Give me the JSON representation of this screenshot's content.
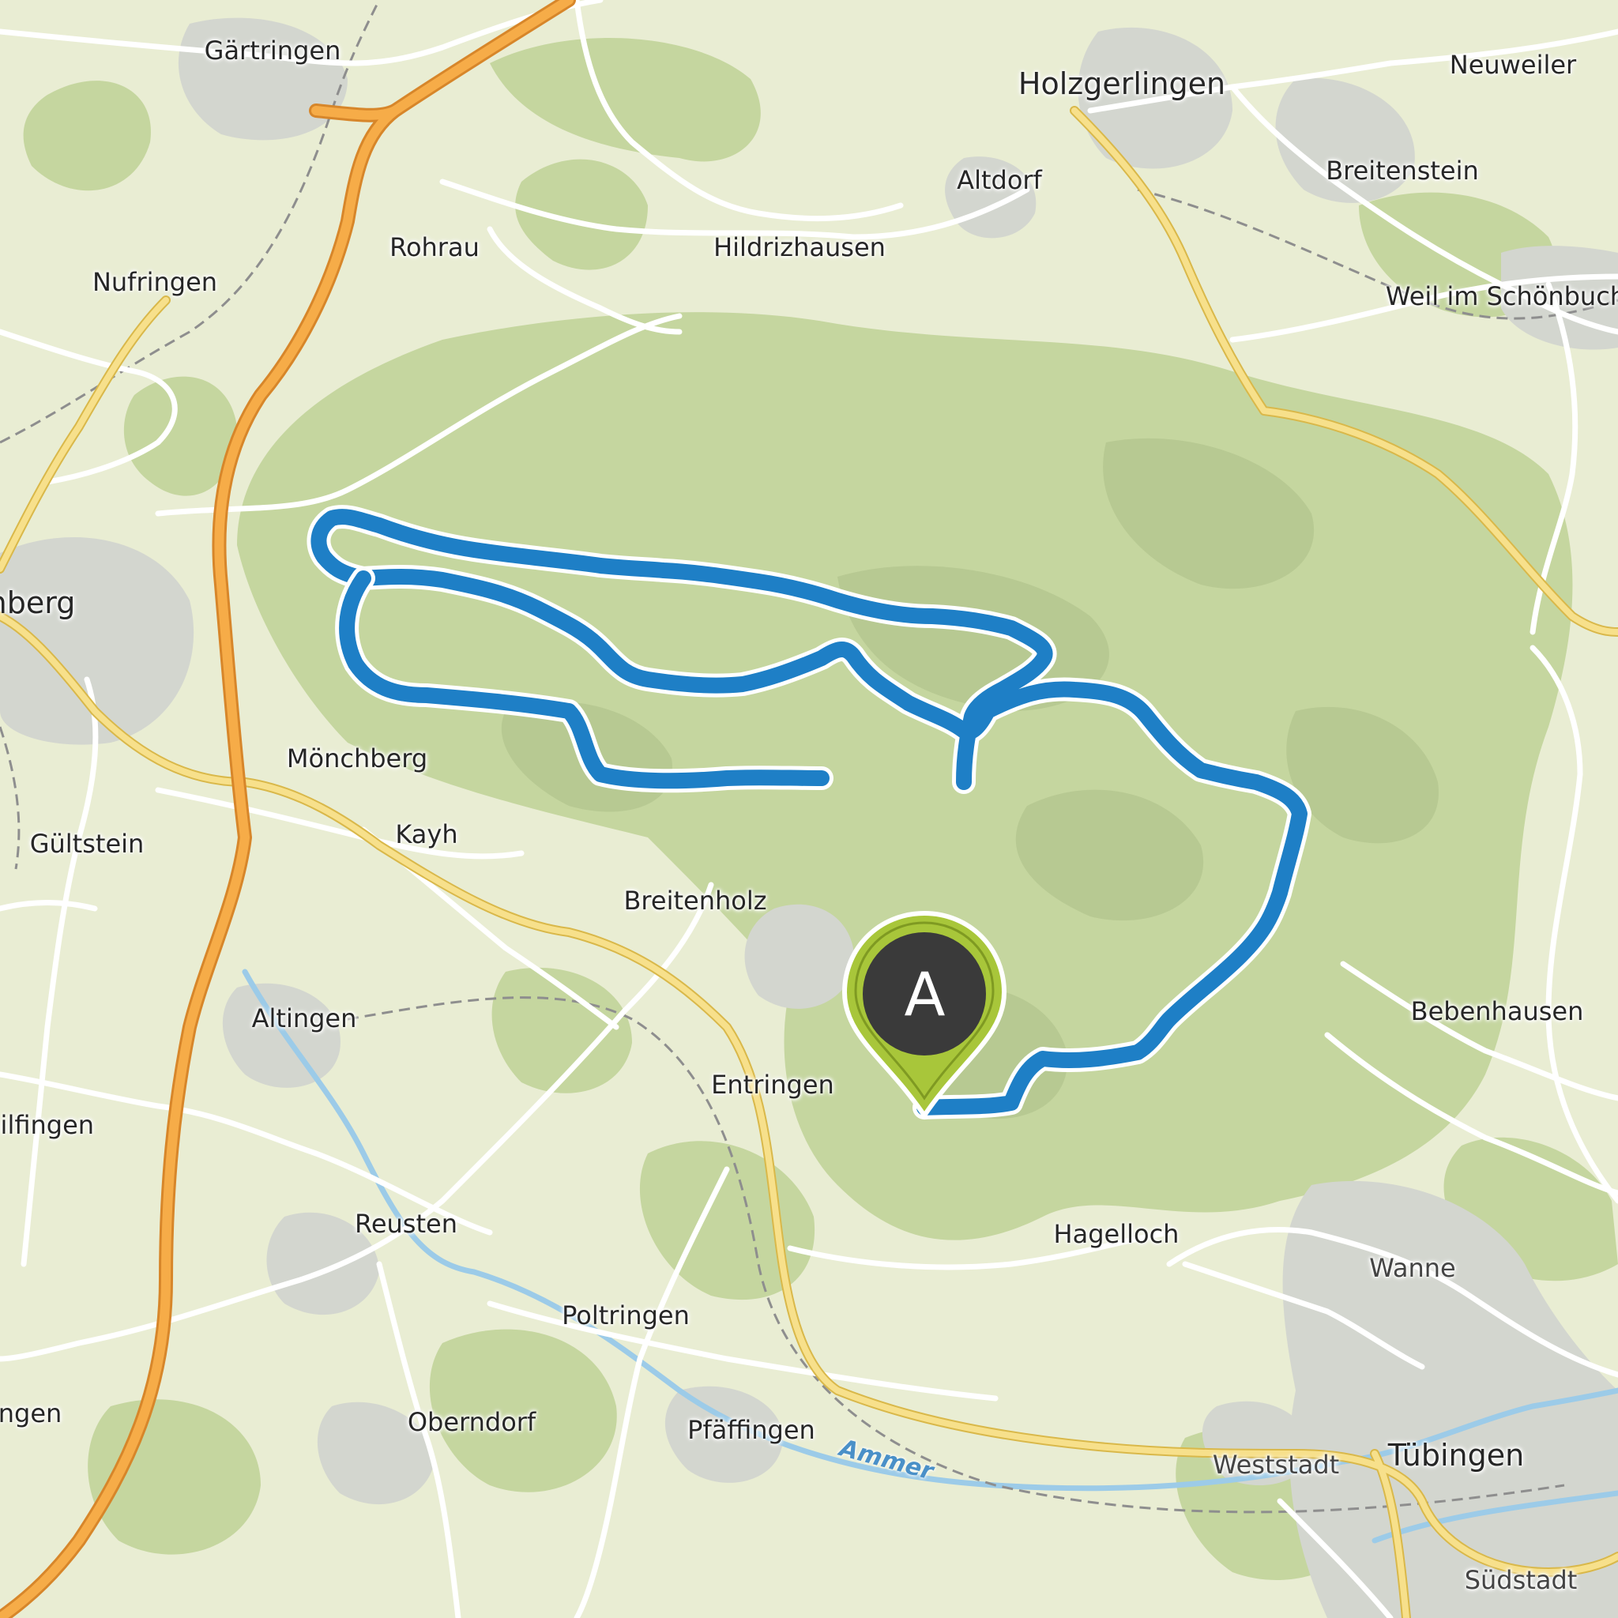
{
  "map": {
    "route_color": "#1e7fc6",
    "forest_color": "#c6d7a0",
    "motorway_color": "#f4a53c",
    "primary_road_color": "#f5dc82"
  },
  "places": {
    "gaertringen": "Gärtringen",
    "holzgerlingen": "Holzgerlingen",
    "neuweiler": "Neuweiler",
    "breitenstein": "Breitenstein",
    "altdorf": "Altdorf",
    "rohrau": "Rohrau",
    "hildrizhausen": "Hildrizhausen",
    "nufringen": "Nufringen",
    "weil_im_schoenbuch": "Weil im Schönbuch",
    "herrenberg_partial": "nberg",
    "moenchberg": "Mönchberg",
    "kayh": "Kayh",
    "gueltstein": "Gültstein",
    "breitenholz": "Breitenholz",
    "altingen": "Altingen",
    "entringen": "Entringen",
    "bebenhausen": "Bebenhausen",
    "ailfingen_partial": "ailfingen",
    "reusten": "Reusten",
    "hagelloch": "Hagelloch",
    "wanne": "Wanne",
    "poltringen": "Poltringen",
    "ngen_partial": "ngen",
    "oberndorf": "Oberndorf",
    "pfaeffingen": "Pfäffingen",
    "weststadt": "Weststadt",
    "tuebingen": "Tübingen",
    "suedstadt": "Südstadt"
  },
  "rivers": {
    "ammer": "Ammer"
  },
  "start_marker": {
    "letter": "A",
    "color": "#a8c63a",
    "badge_color": "#3a3a3a",
    "icon": "map-pin-icon"
  }
}
